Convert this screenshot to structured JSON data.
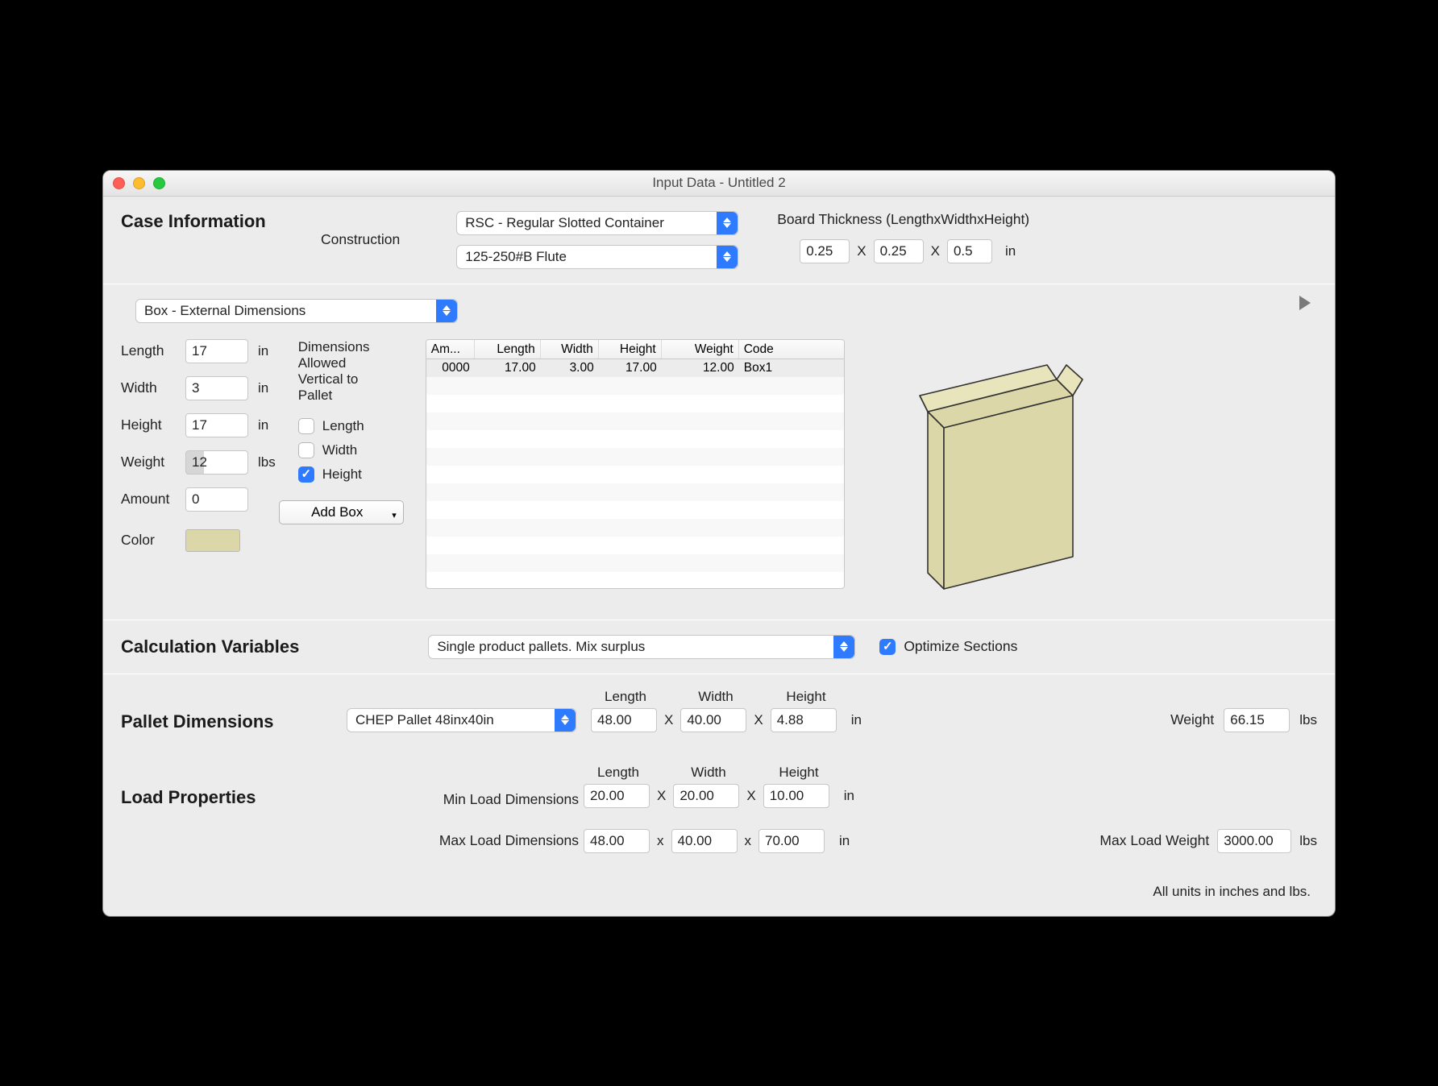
{
  "window": {
    "title": "Input Data - Untitled 2"
  },
  "case": {
    "heading": "Case Information",
    "construction_label": "Construction",
    "construction_select": "RSC - Regular Slotted Container",
    "flute_select": "125-250#B Flute",
    "thickness_label": "Board Thickness (LengthxWidthxHeight)",
    "thickness_l": "0.25",
    "thickness_w": "0.25",
    "thickness_h": "0.5",
    "thickness_unit": "in"
  },
  "box": {
    "dim_select": "Box - External Dimensions",
    "labels": {
      "length": "Length",
      "width": "Width",
      "height": "Height",
      "weight": "Weight",
      "amount": "Amount",
      "color": "Color",
      "lbs": "lbs",
      "in": "in"
    },
    "length": "17",
    "width": "3",
    "height": "17",
    "weight": "12",
    "amount": "0",
    "allowed": {
      "heading1": "Dimensions",
      "heading2": "Allowed",
      "heading3": "Vertical to",
      "heading4": "Pallet",
      "length": "Length",
      "width": "Width",
      "height": "Height"
    },
    "add_button": "Add Box",
    "table": {
      "headers": {
        "am": "Am...",
        "length": "Length",
        "width": "Width",
        "height": "Height",
        "weight": "Weight",
        "code": "Code"
      },
      "row": {
        "am": "0000",
        "length": "17.00",
        "width": "3.00",
        "height": "17.00",
        "weight": "12.00",
        "code": "Box1"
      }
    },
    "color_hex": "#dcd7a8"
  },
  "calc": {
    "heading": "Calculation Variables",
    "select": "Single product pallets. Mix surplus",
    "optimize": "Optimize Sections"
  },
  "pallet": {
    "heading": "Pallet Dimensions",
    "select": "CHEP Pallet 48inx40in",
    "l_lbl": "Length",
    "w_lbl": "Width",
    "h_lbl": "Height",
    "length": "48.00",
    "width": "40.00",
    "height": "4.88",
    "unit": "in",
    "weight_lbl": "Weight",
    "weight": "66.15",
    "weight_unit": "lbs"
  },
  "load": {
    "heading": "Load Properties",
    "l_lbl": "Length",
    "w_lbl": "Width",
    "h_lbl": "Height",
    "min_lbl": "Min Load Dimensions",
    "min_l": "20.00",
    "min_w": "20.00",
    "min_h": "10.00",
    "min_unit": "in",
    "max_lbl": "Max Load Dimensions",
    "max_l": "48.00",
    "max_w": "40.00",
    "max_h": "70.00",
    "max_unit": "in",
    "maxw_lbl": "Max Load Weight",
    "maxw": "3000.00",
    "maxw_unit": "lbs"
  },
  "footer": "All units in inches and lbs.",
  "x": "X",
  "x_lc": "x"
}
